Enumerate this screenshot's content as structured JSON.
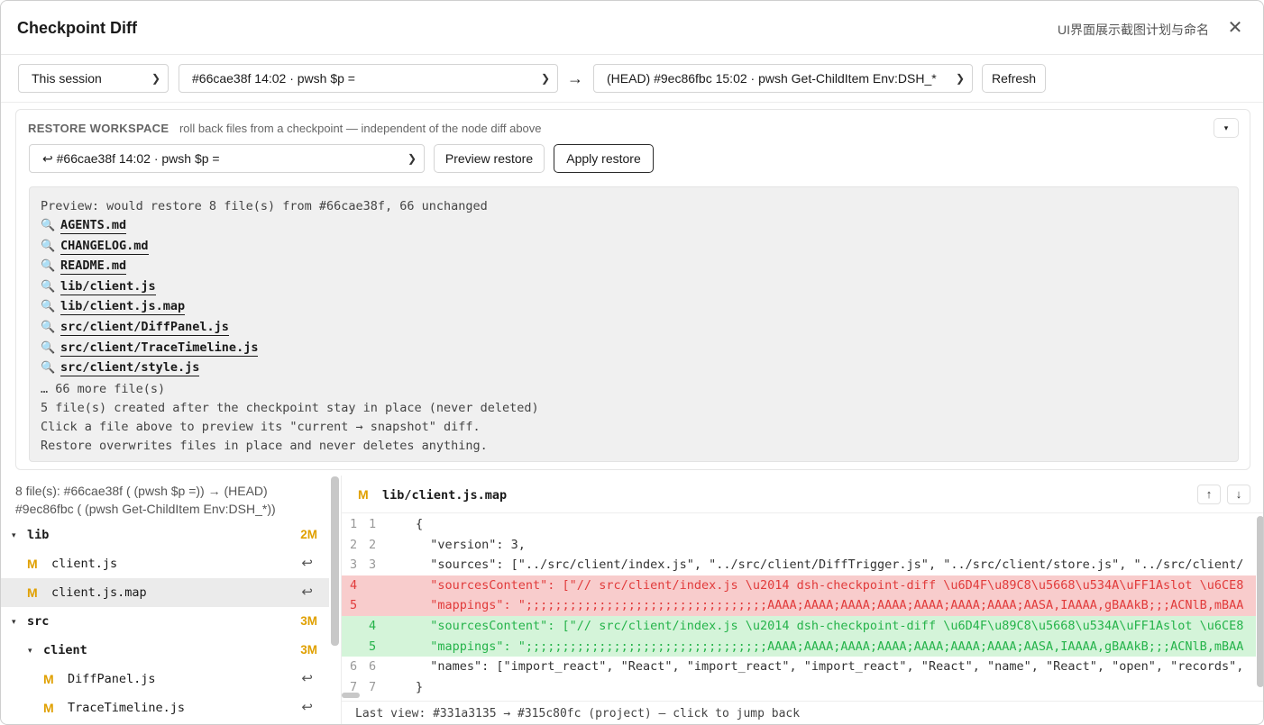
{
  "header": {
    "title": "Checkpoint Diff",
    "subtitle": "UI界面展示截图计划与命名",
    "close_label": "✕"
  },
  "toolbar": {
    "scope_select": "This session",
    "from_select": "#66cae38f 14:02 · pwsh $p =",
    "arrow": "→",
    "to_select": "(HEAD) #9ec86fbc 15:02 · pwsh Get-ChildItem Env:DSH_*",
    "refresh_label": "Refresh"
  },
  "restore": {
    "heading": "RESTORE WORKSPACE",
    "description": "roll back files from a checkpoint — independent of the node diff above",
    "toggle": "▾",
    "checkpoint_select": "↩ #66cae38f 14:02 · pwsh $p =",
    "preview_label": "Preview restore",
    "apply_label": "Apply restore",
    "preview": {
      "summary": "Preview: would restore 8 file(s) from #66cae38f, 66 unchanged",
      "files": [
        "AGENTS.md",
        "CHANGELOG.md",
        "README.md",
        "lib/client.js",
        "lib/client.js.map",
        "src/client/DiffPanel.js",
        "src/client/TraceTimeline.js",
        "src/client/style.js"
      ],
      "more": "… 66 more file(s)",
      "created_note": "5 file(s) created after the checkpoint stay in place (never deleted)",
      "click_note": "Click a file above to preview its \"current → snapshot\" diff.",
      "overwrite_note": "Restore overwrites files in place and never deletes anything."
    }
  },
  "tree": {
    "summary_line1": "8 file(s): #66cae38f ( (pwsh $p =)) → (HEAD)",
    "summary_line2": "#9ec86fbc ( (pwsh Get-ChildItem Env:DSH_*))",
    "rows": [
      {
        "type": "dir",
        "name": "lib",
        "count": "2M"
      },
      {
        "type": "file",
        "mark": "M",
        "name": "client.js"
      },
      {
        "type": "file",
        "mark": "M",
        "name": "client.js.map"
      },
      {
        "type": "dir",
        "name": "src",
        "count": "3M"
      },
      {
        "type": "dir",
        "name": "client",
        "count": "3M"
      },
      {
        "type": "file",
        "mark": "M",
        "name": "DiffPanel.js"
      },
      {
        "type": "file",
        "mark": "M",
        "name": "TraceTimeline.js"
      }
    ],
    "undo_icon": "↩"
  },
  "diff": {
    "mark": "M",
    "file": "lib/client.js.map",
    "up": "↑",
    "down": "↓",
    "lines": [
      {
        "kind": "ctx",
        "l": "1",
        "r": "1",
        "text": "{"
      },
      {
        "kind": "ctx",
        "l": "2",
        "r": "2",
        "text": "  \"version\": 3,"
      },
      {
        "kind": "ctx",
        "l": "3",
        "r": "3",
        "text": "  \"sources\": [\"../src/client/index.js\", \"../src/client/DiffTrigger.js\", \"../src/client/store.js\", \"../src/client/"
      },
      {
        "kind": "del",
        "l": "4",
        "r": "",
        "text": "  \"sourcesContent\": [\"// src/client/index.js \\u2014 dsh-checkpoint-diff \\u6D4F\\u89C8\\u5668\\u534A\\uFF1Aslot \\u6CE8"
      },
      {
        "kind": "del",
        "l": "5",
        "r": "",
        "text": "  \"mappings\": \";;;;;;;;;;;;;;;;;;;;;;;;;;;;;;;;;AAAA;AAAA;AAAA;AAAA;AAAA;AAAA;AAAA;AASA,IAAAA,gBAAkB;;;ACNlB,mBAA"
      },
      {
        "kind": "add",
        "l": "",
        "r": "4",
        "text": "  \"sourcesContent\": [\"// src/client/index.js \\u2014 dsh-checkpoint-diff \\u6D4F\\u89C8\\u5668\\u534A\\uFF1Aslot \\u6CE8"
      },
      {
        "kind": "add",
        "l": "",
        "r": "5",
        "text": "  \"mappings\": \";;;;;;;;;;;;;;;;;;;;;;;;;;;;;;;;;AAAA;AAAA;AAAA;AAAA;AAAA;AAAA;AAAA;AASA,IAAAA,gBAAkB;;;ACNlB,mBAA"
      },
      {
        "kind": "ctx",
        "l": "6",
        "r": "6",
        "text": "  \"names\": [\"import_react\", \"React\", \"import_react\", \"import_react\", \"React\", \"name\", \"React\", \"open\", \"records\","
      },
      {
        "kind": "ctx",
        "l": "7",
        "r": "7",
        "text": "}"
      }
    ],
    "footer": "Last view: #331a3135 → #315c80fc (project) — click to jump back"
  }
}
